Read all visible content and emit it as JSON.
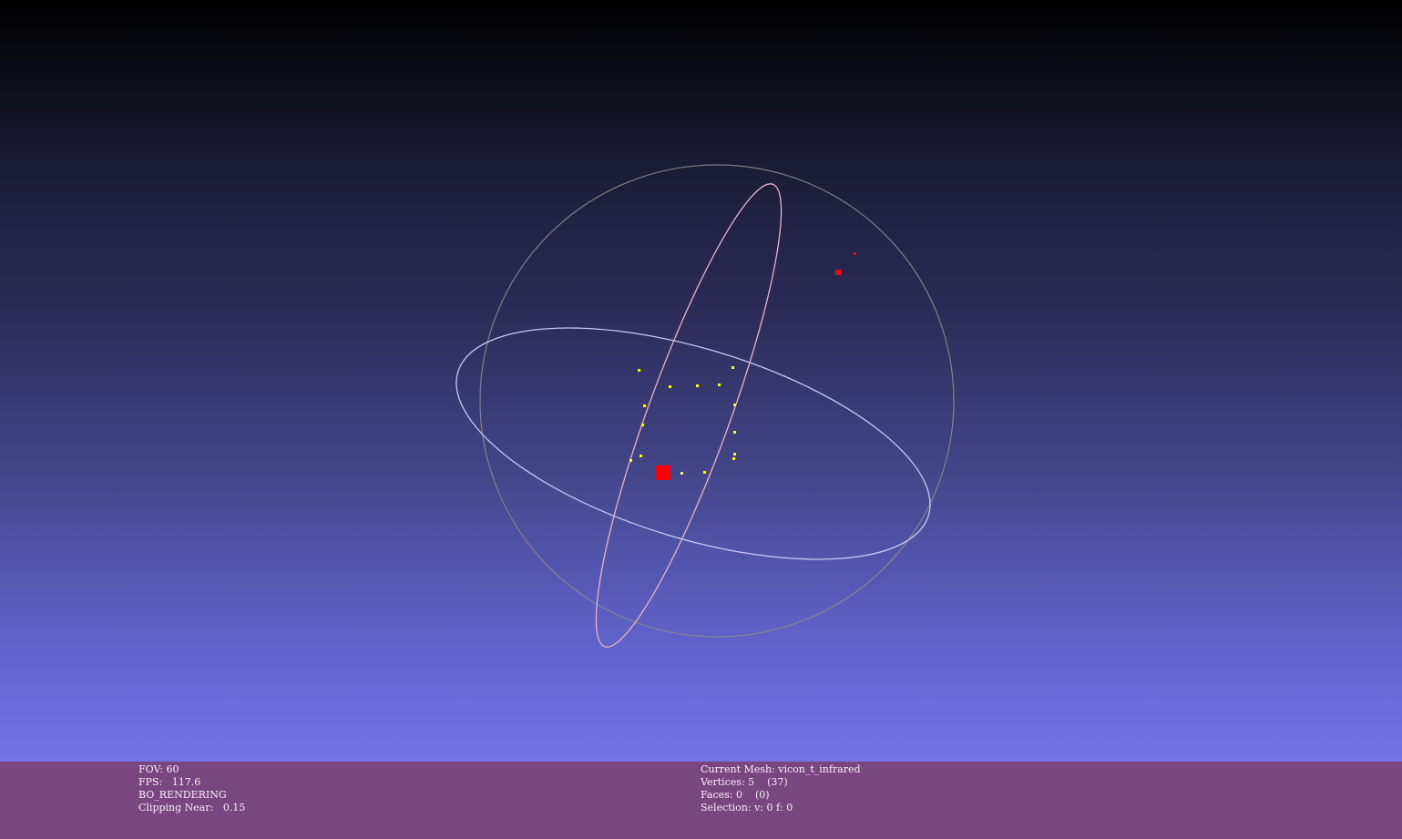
{
  "viewport": {
    "background_gradient": [
      "#000000",
      "#2d2c5a",
      "#7474e8"
    ],
    "trackball": {
      "sphere_color": "#8a8a8a",
      "ring_x_color": "#e6b3c8",
      "ring_y_color": "#bfc3f2",
      "ring_z_color": "#7e7e8e"
    },
    "point_color": "#ffff00",
    "selected_color": "#ff0000"
  },
  "info_left": {
    "fov": "FOV: 60",
    "fps": "FPS:   117.6",
    "rendering": "BO_RENDERING",
    "clipping": "Clipping Near:   0.15"
  },
  "info_right": {
    "current_mesh": "Current Mesh: vicon_t_infrared",
    "vertices": "Vertices: 5    (37)",
    "faces": "Faces: 0    (0)",
    "selection": "Selection: v: 0 f: 0"
  },
  "colors": {
    "info_bar_bg": "#7a4680",
    "info_text": "#f4f1f4"
  }
}
